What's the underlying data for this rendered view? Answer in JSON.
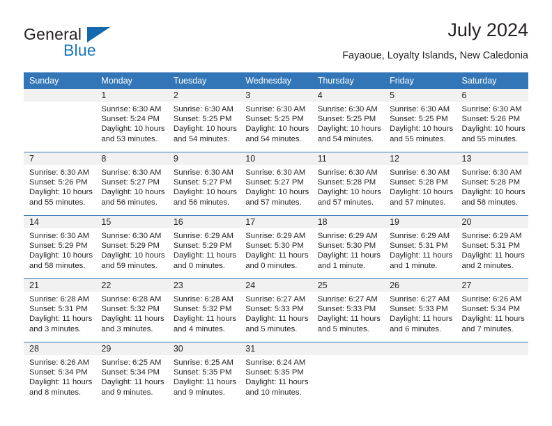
{
  "brand": {
    "name_part1": "General",
    "name_part2": "Blue",
    "triangle_icon": "triangle-icon",
    "accent_color": "#1b75bb"
  },
  "header": {
    "title": "July 2024",
    "subtitle": "Fayaoue, Loyalty Islands, New Caledonia"
  },
  "calendar": {
    "header_bg": "#3276b8",
    "daynum_bg": "#f1f1f1",
    "weekday_headers": [
      "Sunday",
      "Monday",
      "Tuesday",
      "Wednesday",
      "Thursday",
      "Friday",
      "Saturday"
    ],
    "weeks": [
      [
        {
          "day": "",
          "empty": true,
          "sunrise": "",
          "sunset": "",
          "daylight_line1": "",
          "daylight_line2": ""
        },
        {
          "day": "1",
          "sunrise": "Sunrise: 6:30 AM",
          "sunset": "Sunset: 5:24 PM",
          "daylight_line1": "Daylight: 10 hours",
          "daylight_line2": "and 53 minutes."
        },
        {
          "day": "2",
          "sunrise": "Sunrise: 6:30 AM",
          "sunset": "Sunset: 5:25 PM",
          "daylight_line1": "Daylight: 10 hours",
          "daylight_line2": "and 54 minutes."
        },
        {
          "day": "3",
          "sunrise": "Sunrise: 6:30 AM",
          "sunset": "Sunset: 5:25 PM",
          "daylight_line1": "Daylight: 10 hours",
          "daylight_line2": "and 54 minutes."
        },
        {
          "day": "4",
          "sunrise": "Sunrise: 6:30 AM",
          "sunset": "Sunset: 5:25 PM",
          "daylight_line1": "Daylight: 10 hours",
          "daylight_line2": "and 54 minutes."
        },
        {
          "day": "5",
          "sunrise": "Sunrise: 6:30 AM",
          "sunset": "Sunset: 5:25 PM",
          "daylight_line1": "Daylight: 10 hours",
          "daylight_line2": "and 55 minutes."
        },
        {
          "day": "6",
          "sunrise": "Sunrise: 6:30 AM",
          "sunset": "Sunset: 5:26 PM",
          "daylight_line1": "Daylight: 10 hours",
          "daylight_line2": "and 55 minutes."
        }
      ],
      [
        {
          "day": "7",
          "sunrise": "Sunrise: 6:30 AM",
          "sunset": "Sunset: 5:26 PM",
          "daylight_line1": "Daylight: 10 hours",
          "daylight_line2": "and 55 minutes."
        },
        {
          "day": "8",
          "sunrise": "Sunrise: 6:30 AM",
          "sunset": "Sunset: 5:27 PM",
          "daylight_line1": "Daylight: 10 hours",
          "daylight_line2": "and 56 minutes."
        },
        {
          "day": "9",
          "sunrise": "Sunrise: 6:30 AM",
          "sunset": "Sunset: 5:27 PM",
          "daylight_line1": "Daylight: 10 hours",
          "daylight_line2": "and 56 minutes."
        },
        {
          "day": "10",
          "sunrise": "Sunrise: 6:30 AM",
          "sunset": "Sunset: 5:27 PM",
          "daylight_line1": "Daylight: 10 hours",
          "daylight_line2": "and 57 minutes."
        },
        {
          "day": "11",
          "sunrise": "Sunrise: 6:30 AM",
          "sunset": "Sunset: 5:28 PM",
          "daylight_line1": "Daylight: 10 hours",
          "daylight_line2": "and 57 minutes."
        },
        {
          "day": "12",
          "sunrise": "Sunrise: 6:30 AM",
          "sunset": "Sunset: 5:28 PM",
          "daylight_line1": "Daylight: 10 hours",
          "daylight_line2": "and 57 minutes."
        },
        {
          "day": "13",
          "sunrise": "Sunrise: 6:30 AM",
          "sunset": "Sunset: 5:28 PM",
          "daylight_line1": "Daylight: 10 hours",
          "daylight_line2": "and 58 minutes."
        }
      ],
      [
        {
          "day": "14",
          "sunrise": "Sunrise: 6:30 AM",
          "sunset": "Sunset: 5:29 PM",
          "daylight_line1": "Daylight: 10 hours",
          "daylight_line2": "and 58 minutes."
        },
        {
          "day": "15",
          "sunrise": "Sunrise: 6:30 AM",
          "sunset": "Sunset: 5:29 PM",
          "daylight_line1": "Daylight: 10 hours",
          "daylight_line2": "and 59 minutes."
        },
        {
          "day": "16",
          "sunrise": "Sunrise: 6:29 AM",
          "sunset": "Sunset: 5:29 PM",
          "daylight_line1": "Daylight: 11 hours",
          "daylight_line2": "and 0 minutes."
        },
        {
          "day": "17",
          "sunrise": "Sunrise: 6:29 AM",
          "sunset": "Sunset: 5:30 PM",
          "daylight_line1": "Daylight: 11 hours",
          "daylight_line2": "and 0 minutes."
        },
        {
          "day": "18",
          "sunrise": "Sunrise: 6:29 AM",
          "sunset": "Sunset: 5:30 PM",
          "daylight_line1": "Daylight: 11 hours",
          "daylight_line2": "and 1 minute."
        },
        {
          "day": "19",
          "sunrise": "Sunrise: 6:29 AM",
          "sunset": "Sunset: 5:31 PM",
          "daylight_line1": "Daylight: 11 hours",
          "daylight_line2": "and 1 minute."
        },
        {
          "day": "20",
          "sunrise": "Sunrise: 6:29 AM",
          "sunset": "Sunset: 5:31 PM",
          "daylight_line1": "Daylight: 11 hours",
          "daylight_line2": "and 2 minutes."
        }
      ],
      [
        {
          "day": "21",
          "sunrise": "Sunrise: 6:28 AM",
          "sunset": "Sunset: 5:31 PM",
          "daylight_line1": "Daylight: 11 hours",
          "daylight_line2": "and 3 minutes."
        },
        {
          "day": "22",
          "sunrise": "Sunrise: 6:28 AM",
          "sunset": "Sunset: 5:32 PM",
          "daylight_line1": "Daylight: 11 hours",
          "daylight_line2": "and 3 minutes."
        },
        {
          "day": "23",
          "sunrise": "Sunrise: 6:28 AM",
          "sunset": "Sunset: 5:32 PM",
          "daylight_line1": "Daylight: 11 hours",
          "daylight_line2": "and 4 minutes."
        },
        {
          "day": "24",
          "sunrise": "Sunrise: 6:27 AM",
          "sunset": "Sunset: 5:33 PM",
          "daylight_line1": "Daylight: 11 hours",
          "daylight_line2": "and 5 minutes."
        },
        {
          "day": "25",
          "sunrise": "Sunrise: 6:27 AM",
          "sunset": "Sunset: 5:33 PM",
          "daylight_line1": "Daylight: 11 hours",
          "daylight_line2": "and 5 minutes."
        },
        {
          "day": "26",
          "sunrise": "Sunrise: 6:27 AM",
          "sunset": "Sunset: 5:33 PM",
          "daylight_line1": "Daylight: 11 hours",
          "daylight_line2": "and 6 minutes."
        },
        {
          "day": "27",
          "sunrise": "Sunrise: 6:26 AM",
          "sunset": "Sunset: 5:34 PM",
          "daylight_line1": "Daylight: 11 hours",
          "daylight_line2": "and 7 minutes."
        }
      ],
      [
        {
          "day": "28",
          "sunrise": "Sunrise: 6:26 AM",
          "sunset": "Sunset: 5:34 PM",
          "daylight_line1": "Daylight: 11 hours",
          "daylight_line2": "and 8 minutes."
        },
        {
          "day": "29",
          "sunrise": "Sunrise: 6:25 AM",
          "sunset": "Sunset: 5:34 PM",
          "daylight_line1": "Daylight: 11 hours",
          "daylight_line2": "and 9 minutes."
        },
        {
          "day": "30",
          "sunrise": "Sunrise: 6:25 AM",
          "sunset": "Sunset: 5:35 PM",
          "daylight_line1": "Daylight: 11 hours",
          "daylight_line2": "and 9 minutes."
        },
        {
          "day": "31",
          "sunrise": "Sunrise: 6:24 AM",
          "sunset": "Sunset: 5:35 PM",
          "daylight_line1": "Daylight: 11 hours",
          "daylight_line2": "and 10 minutes."
        },
        {
          "day": "",
          "empty": true,
          "sunrise": "",
          "sunset": "",
          "daylight_line1": "",
          "daylight_line2": ""
        },
        {
          "day": "",
          "empty": true,
          "sunrise": "",
          "sunset": "",
          "daylight_line1": "",
          "daylight_line2": ""
        },
        {
          "day": "",
          "empty": true,
          "sunrise": "",
          "sunset": "",
          "daylight_line1": "",
          "daylight_line2": ""
        }
      ]
    ]
  }
}
